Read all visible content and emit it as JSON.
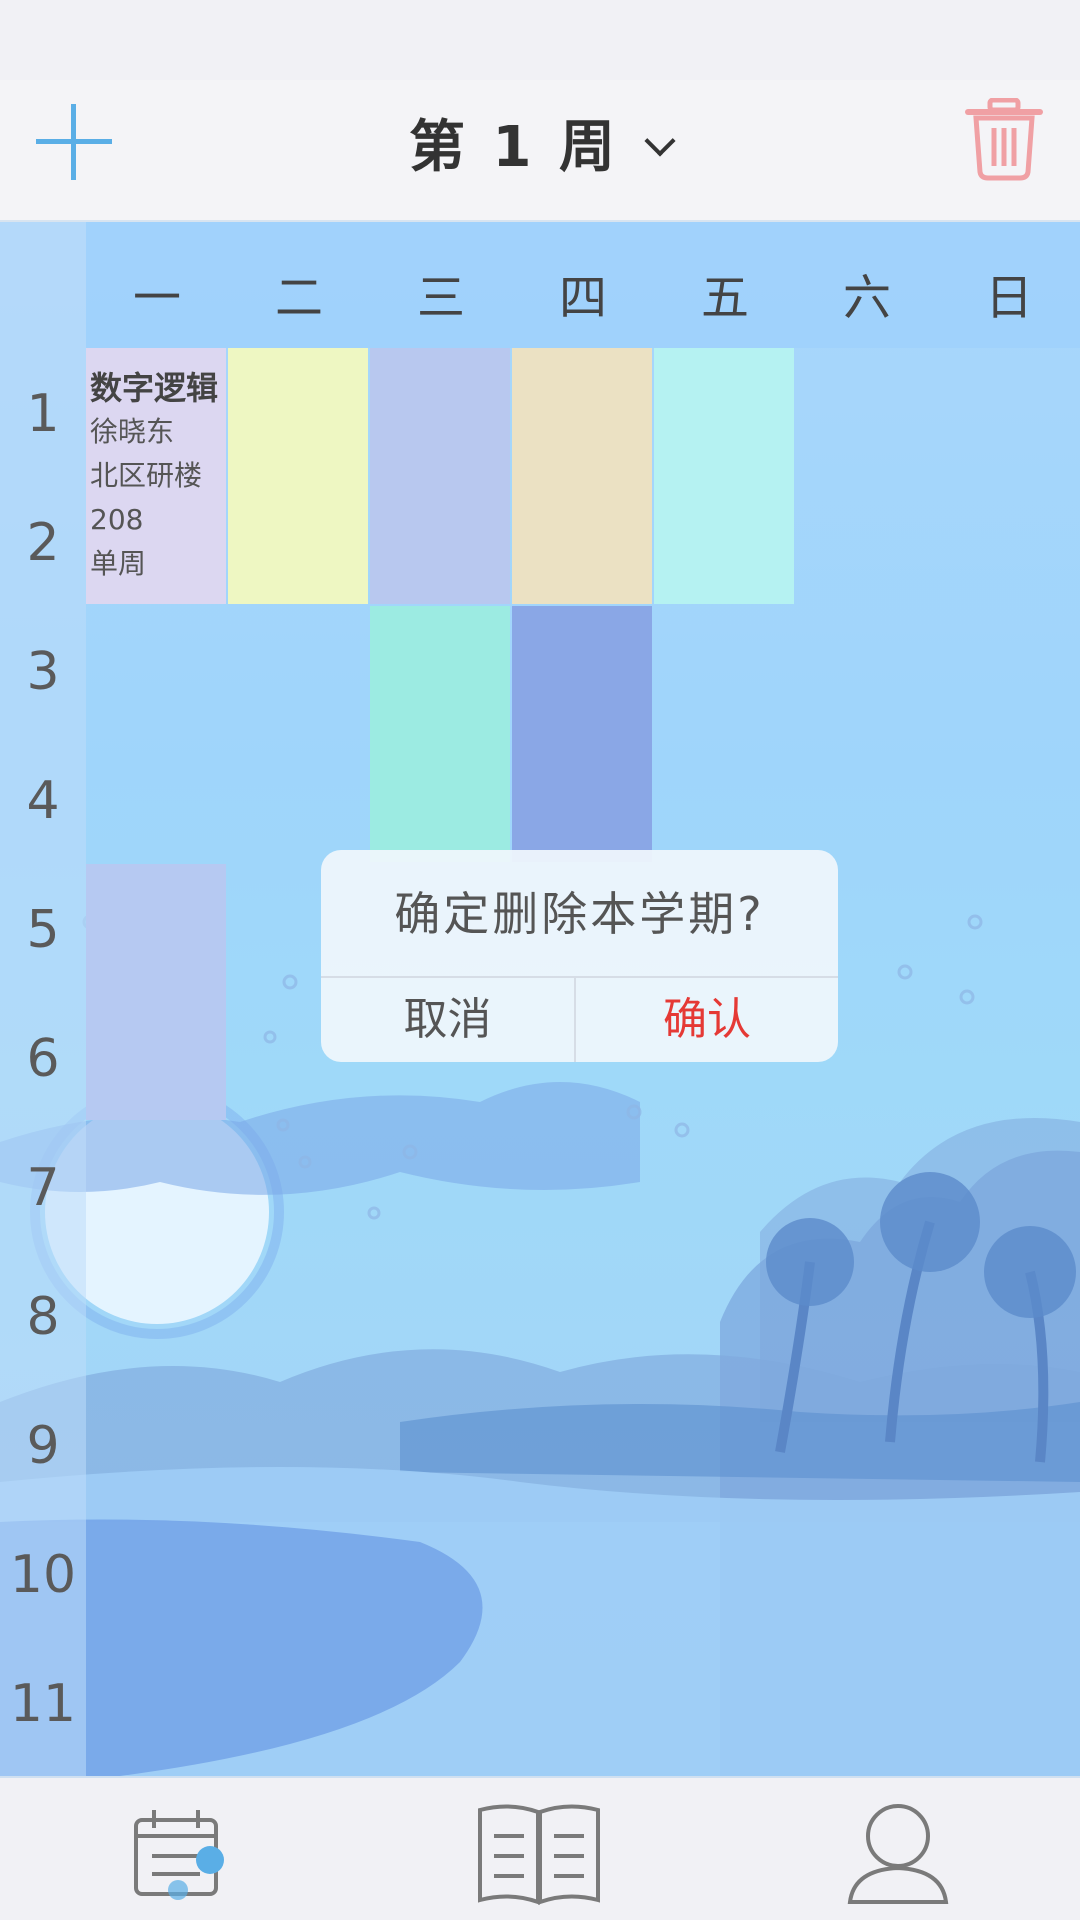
{
  "header": {
    "add_icon": "plus-icon",
    "week_title": "第 1 周",
    "week_dropdown_icon": "chevron-down-icon",
    "delete_icon": "trash-icon"
  },
  "days": [
    "一",
    "二",
    "三",
    "四",
    "五",
    "六",
    "日"
  ],
  "periods": [
    "1",
    "2",
    "3",
    "4",
    "5",
    "6",
    "7",
    "8",
    "9",
    "10",
    "11"
  ],
  "courses": [
    {
      "day": 1,
      "start": 1,
      "span": 2,
      "color": "#dcd7f1",
      "name": "数字逻辑",
      "teacher": "徐晓东",
      "room": "北区研楼",
      "room_no": "208",
      "weeks": "单周"
    },
    {
      "day": 2,
      "start": 1,
      "span": 2,
      "color": "#eef7c2",
      "name": "",
      "teacher": "",
      "room": "",
      "room_no": "",
      "weeks": ""
    },
    {
      "day": 3,
      "start": 1,
      "span": 2,
      "color": "#b8c8ef",
      "name": "",
      "teacher": "",
      "room": "",
      "room_no": "",
      "weeks": ""
    },
    {
      "day": 4,
      "start": 1,
      "span": 2,
      "color": "#ebe1c3",
      "name": "",
      "teacher": "",
      "room": "",
      "room_no": "",
      "weeks": ""
    },
    {
      "day": 5,
      "start": 1,
      "span": 2,
      "color": "#b5f2f2",
      "name": "",
      "teacher": "",
      "room": "",
      "room_no": "",
      "weeks": ""
    },
    {
      "day": 3,
      "start": 3,
      "span": 2,
      "color": "#9cebe2",
      "name": "",
      "teacher": "",
      "room": "",
      "room_no": "",
      "weeks": ""
    },
    {
      "day": 4,
      "start": 3,
      "span": 2,
      "color": "#8aa7e6",
      "name": "",
      "teacher": "",
      "room": "",
      "room_no": "",
      "weeks": ""
    },
    {
      "day": 1,
      "start": 5,
      "span": 2,
      "color": "#b6c9f2",
      "name": "",
      "teacher": "",
      "room": "",
      "room_no": "",
      "weeks": ""
    }
  ],
  "dialog": {
    "message": "确定删除本学期?",
    "cancel_label": "取消",
    "confirm_label": "确认"
  },
  "bottom_nav": [
    {
      "icon": "calendar-icon"
    },
    {
      "icon": "book-icon"
    },
    {
      "icon": "user-icon"
    }
  ],
  "colors": {
    "accent": "#5aaee6",
    "danger": "#e53935",
    "trash": "#f0a0a4"
  }
}
